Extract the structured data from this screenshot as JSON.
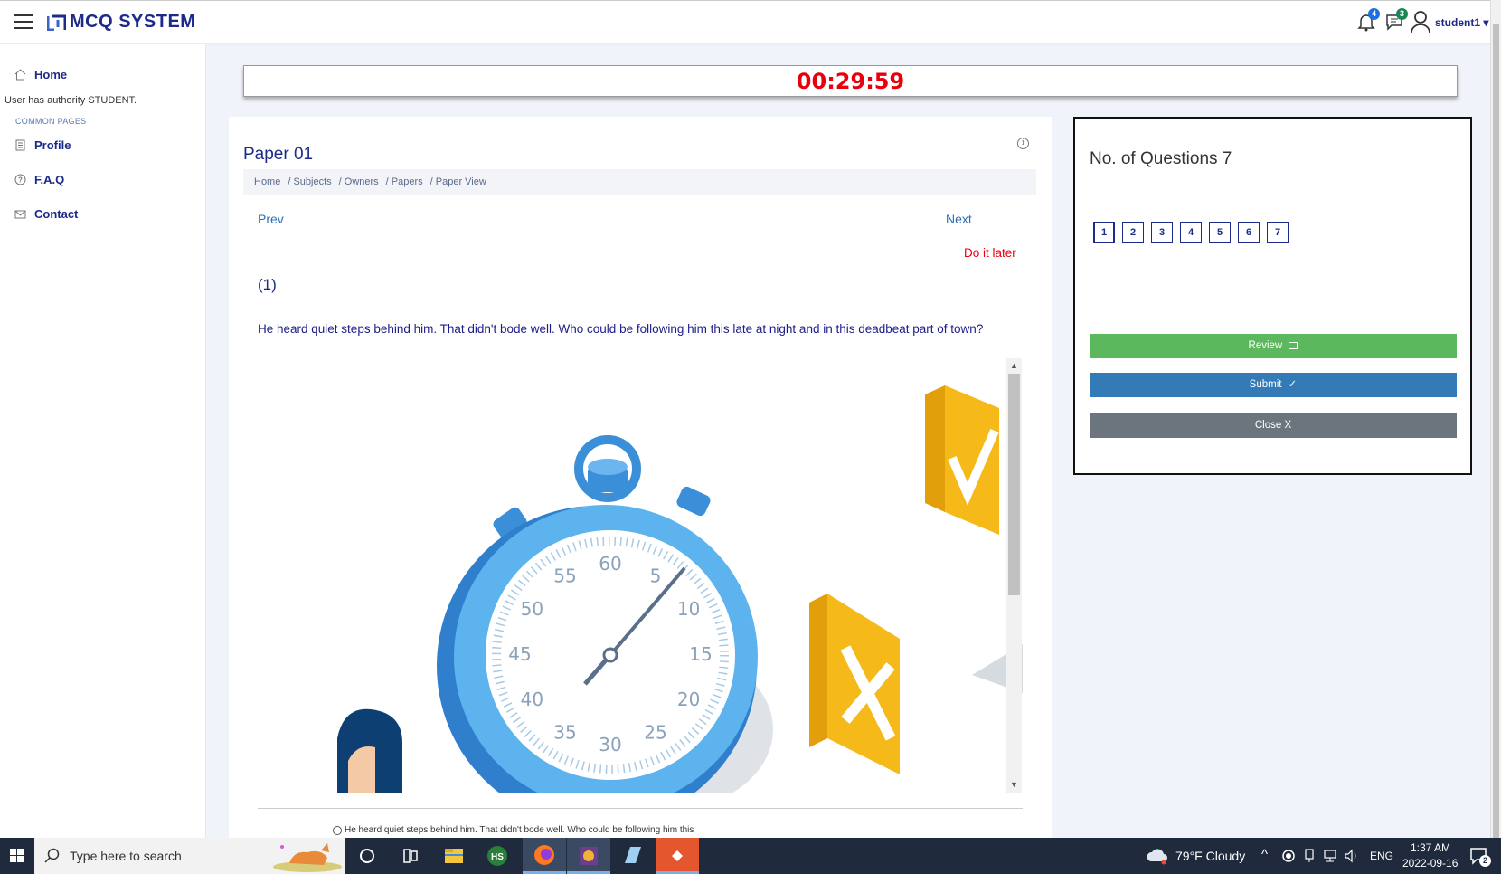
{
  "header": {
    "brand": "MCQ SYSTEM",
    "notifications_count": "4",
    "messages_count": "3",
    "user_name": "student1 ▾"
  },
  "sidebar": {
    "home_label": "Home",
    "authority_note": "User has authority STUDENT.",
    "section_header": "COMMON PAGES",
    "items": [
      {
        "label": "Profile",
        "icon": "document-icon"
      },
      {
        "label": "F.A.Q",
        "icon": "question-icon"
      },
      {
        "label": "Contact",
        "icon": "envelope-icon"
      }
    ]
  },
  "timer": {
    "value": "00:29:59"
  },
  "paper": {
    "title": "Paper 01",
    "breadcrumb": [
      "Home",
      "/ Subjects",
      "/ Owners",
      "/ Papers",
      "/ Paper View"
    ],
    "prev_label": "Prev",
    "next_label": "Next",
    "later_label": "Do it later",
    "question_number": "(1)",
    "question_text": "He heard quiet steps behind him. That didn't bode well. Who could be following him this late at night and in this deadbeat part of town?",
    "option_1": "He heard quiet steps behind him. That didn't bode well. Who could be following him this"
  },
  "stopwatch_labels": [
    "60",
    "5",
    "10",
    "15",
    "20",
    "25",
    "30",
    "35",
    "40",
    "45",
    "50",
    "55"
  ],
  "right_panel": {
    "title": "No. of Questions 7",
    "questions": [
      "1",
      "2",
      "3",
      "4",
      "5",
      "6",
      "7"
    ],
    "active_question": "1",
    "review_label": "Review",
    "submit_label": "Submit",
    "close_label": "Close  X"
  },
  "taskbar": {
    "search_placeholder": "Type here to search",
    "weather": "79°F  Cloudy",
    "language": "ENG",
    "time": "1:37 AM",
    "date": "2022-09-16",
    "notification_count": "2"
  },
  "colors": {
    "brand": "#1c2b8a",
    "timer": "#e8000b",
    "review": "#5cb85c",
    "submit": "#337ab7",
    "close": "#6c757d"
  }
}
